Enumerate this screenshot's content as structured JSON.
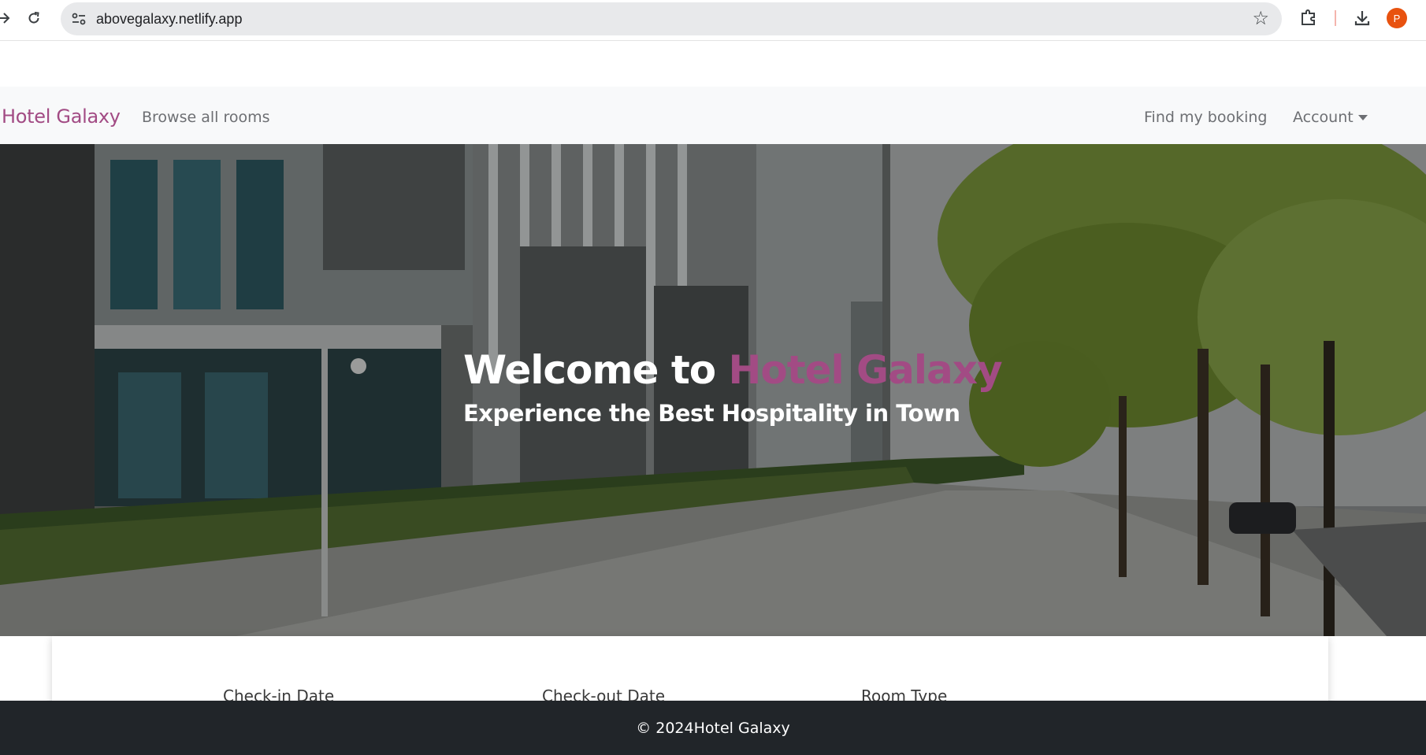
{
  "browser": {
    "url": "abovegalaxy.netlify.app",
    "profile_initial": "P",
    "icons": [
      "back-icon",
      "reload-icon",
      "site-info-icon",
      "bookmark-star-icon",
      "extensions-icon",
      "download-icon"
    ]
  },
  "navbar": {
    "brand": "Hotel Galaxy",
    "browse_link": "Browse all rooms",
    "find_booking_link": "Find my booking",
    "account_dropdown": "Account"
  },
  "hero": {
    "title_prefix": "Welcome to ",
    "title_accent": "Hotel Galaxy",
    "subtitle": "Experience the Best Hospitality in Town"
  },
  "booking": {
    "checkin_label": "Check-in Date",
    "checkout_label": "Check-out Date",
    "room_type_label": "Room Type"
  },
  "footer": {
    "text": "© 2024Hotel Galaxy"
  },
  "colors": {
    "brand_accent": "#a24b84",
    "navbar_bg": "#f8f9fa",
    "footer_bg": "#212529"
  }
}
